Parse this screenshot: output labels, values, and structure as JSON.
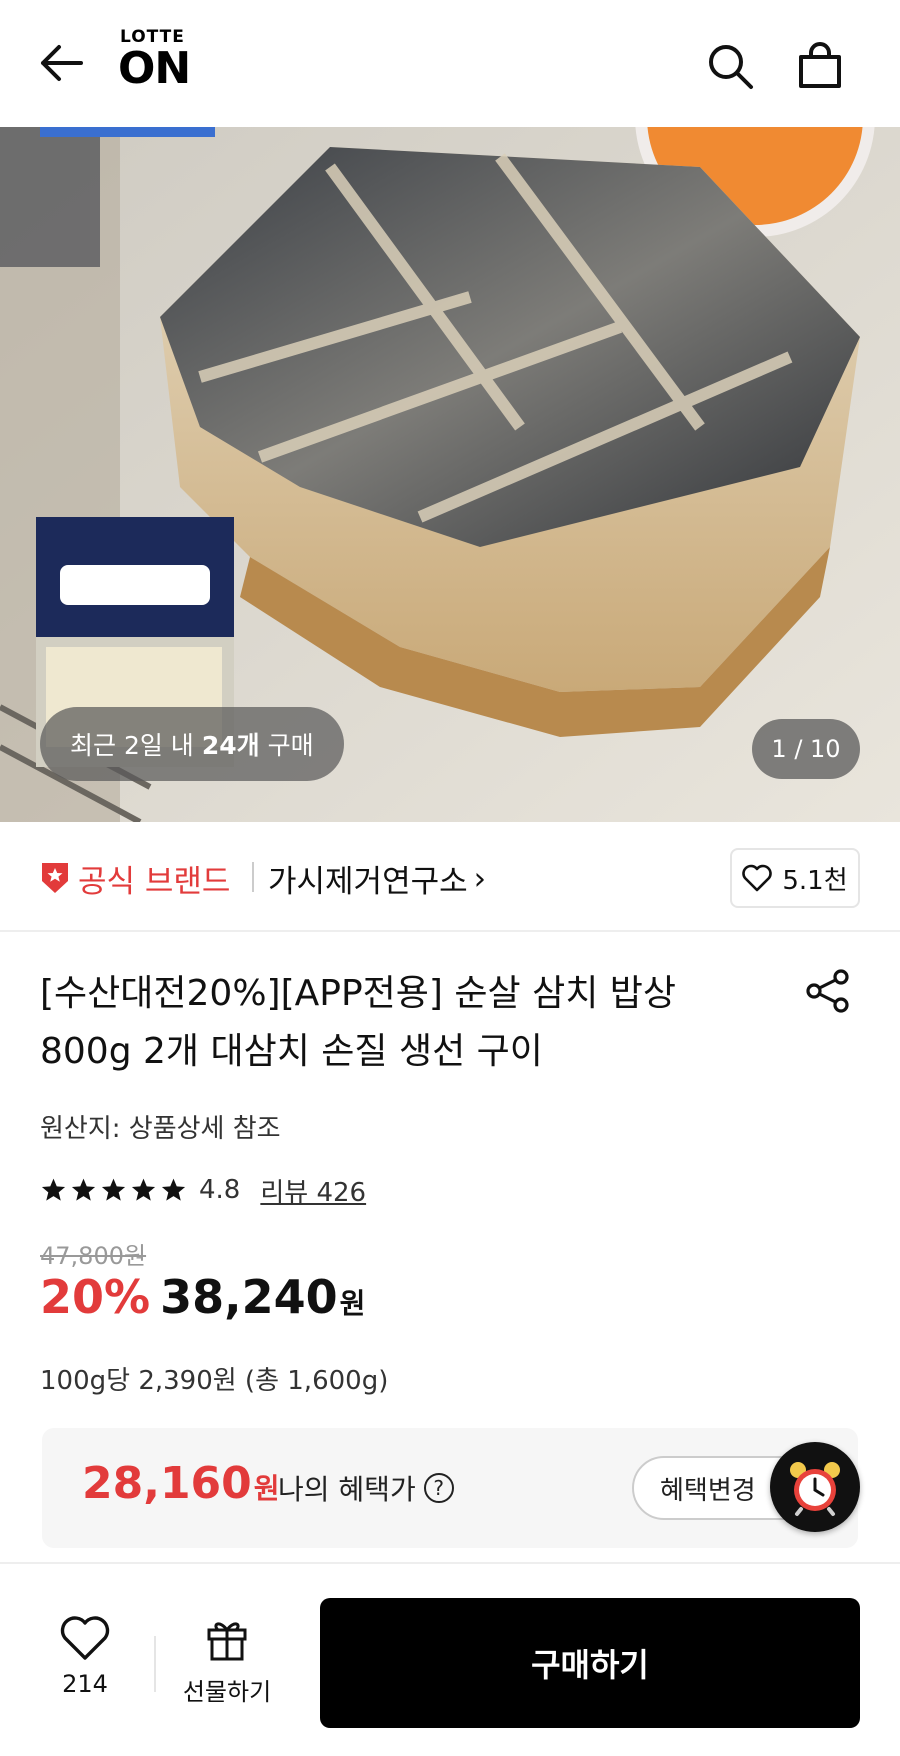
{
  "header": {
    "logo_top": "LOTTE",
    "logo_bottom": "ON"
  },
  "hero": {
    "recent_prefix": "최근 2일 내",
    "recent_count": "24개",
    "recent_suffix": "구매",
    "pager": "1 / 10"
  },
  "brand": {
    "official_label": "공식 브랜드",
    "store_name": "가시제거연구소",
    "store_chevron": "›",
    "like_count": "5.1천"
  },
  "product": {
    "title": "[수산대전20%][APP전용] 순살 삼치 밥상 800g 2개 대삼치 손질 생선 구이",
    "origin": "원산지: 상품상세 참조",
    "rating": 4.8,
    "rating_text": "4.8",
    "review_link": "리뷰 426",
    "original_price": "47,800원",
    "discount": "20%",
    "sale_price": "38,240",
    "won": "원",
    "unit_price": "100g당 2,390원 (총 1,600g)"
  },
  "benefit": {
    "price": "28,160",
    "won": "원",
    "label": "나의 혜택가",
    "help": "?",
    "change_button": "혜택변경"
  },
  "bottom_bar": {
    "wish_count": "214",
    "gift_label": "선물하기",
    "buy_label": "구매하기"
  },
  "colors": {
    "accent_red": "#e23b3b",
    "buy_button": "#000000"
  },
  "icons": [
    "back-arrow-icon",
    "search-icon",
    "shopping-bag-icon",
    "shield-star-icon",
    "heart-icon",
    "share-icon",
    "star-icon",
    "help-icon",
    "alarm-clock-icon",
    "gift-icon"
  ]
}
